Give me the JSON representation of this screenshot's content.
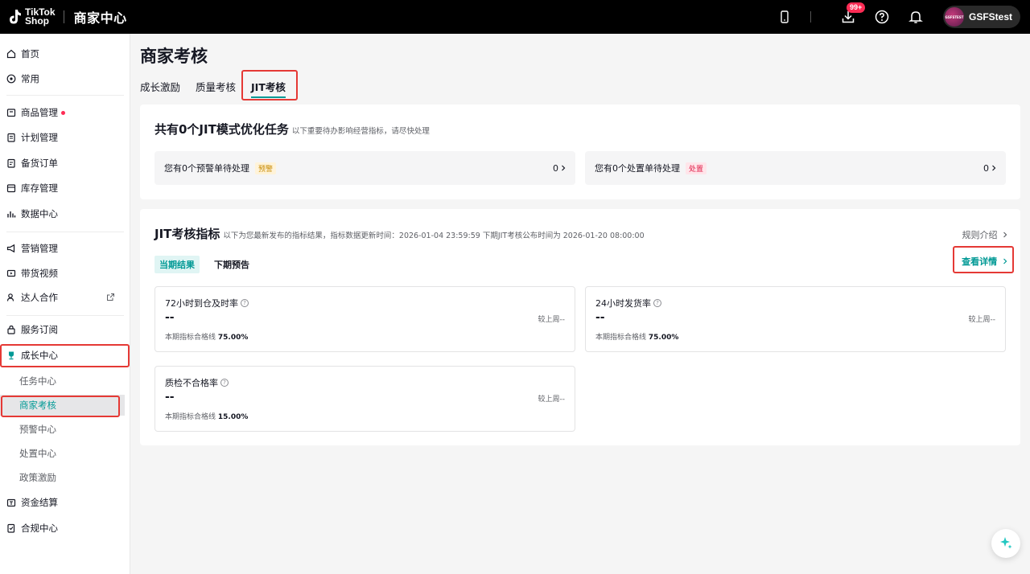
{
  "topbar": {
    "logo_line1": "TikTok",
    "logo_line2": "Shop",
    "app_title": "商家中心",
    "download_badge": "99+",
    "user_name": "GSFStest",
    "avatar_text": "GSFSTEST"
  },
  "sidebar": {
    "items": [
      {
        "label": "首页",
        "icon": "home-icon"
      },
      {
        "label": "常用",
        "icon": "star-circle-icon"
      },
      {
        "label": "商品管理",
        "icon": "product-icon"
      },
      {
        "label": "计划管理",
        "icon": "plan-icon"
      },
      {
        "label": "备货订单",
        "icon": "order-icon"
      },
      {
        "label": "库存管理",
        "icon": "inventory-icon"
      },
      {
        "label": "数据中心",
        "icon": "chart-icon"
      },
      {
        "label": "营销管理",
        "icon": "megaphone-icon"
      },
      {
        "label": "带货视频",
        "icon": "video-icon"
      },
      {
        "label": "达人合作",
        "icon": "creator-icon"
      },
      {
        "label": "服务订阅",
        "icon": "lock-bag-icon"
      },
      {
        "label": "成长中心",
        "icon": "trophy-icon"
      },
      {
        "label": "任务中心"
      },
      {
        "label": "商家考核"
      },
      {
        "label": "预警中心"
      },
      {
        "label": "处置中心"
      },
      {
        "label": "政策激励"
      },
      {
        "label": "资金结算",
        "icon": "wallet-icon"
      },
      {
        "label": "合规中心",
        "icon": "compliance-icon"
      }
    ]
  },
  "main": {
    "page_title": "商家考核",
    "tabs": [
      {
        "label": "成长激励"
      },
      {
        "label": "质量考核"
      },
      {
        "label": "JIT考核"
      }
    ],
    "tasks_card": {
      "title": "共有0个JIT模式优化任务",
      "subtitle": "以下重要待办影响经营指标，请尽快处理",
      "warn_box": {
        "text": "您有0个预警单待处理",
        "tag": "预警",
        "count": "0"
      },
      "action_box": {
        "text": "您有0个处置单待处理",
        "tag": "处置",
        "count": "0"
      }
    },
    "metrics_card": {
      "title": "JIT考核指标",
      "subtitle": "以下为您最新发布的指标结果，指标数据更新时间：2026-01-04 23:59:59  下期JIT考核公布时间为 2026-01-20 08:00:00",
      "rules_link": "规则介绍",
      "detail_link": "查看详情",
      "subtabs": [
        {
          "label": "当期结果"
        },
        {
          "label": "下期预告"
        }
      ],
      "metrics": [
        {
          "name": "72小时到仓及时率",
          "value": "--",
          "compare": "较上周--",
          "threshold_label": "本期指标合格线",
          "threshold": "75.00%"
        },
        {
          "name": "24小时发货率",
          "value": "--",
          "compare": "较上周--",
          "threshold_label": "本期指标合格线",
          "threshold": "75.00%"
        },
        {
          "name": "质检不合格率",
          "value": "--",
          "compare": "较上周--",
          "threshold_label": "本期指标合格线",
          "threshold": "15.00%"
        }
      ]
    }
  },
  "colors": {
    "accent": "#009995",
    "highlight_box": "#e53935",
    "badge": "#fe2c55"
  }
}
